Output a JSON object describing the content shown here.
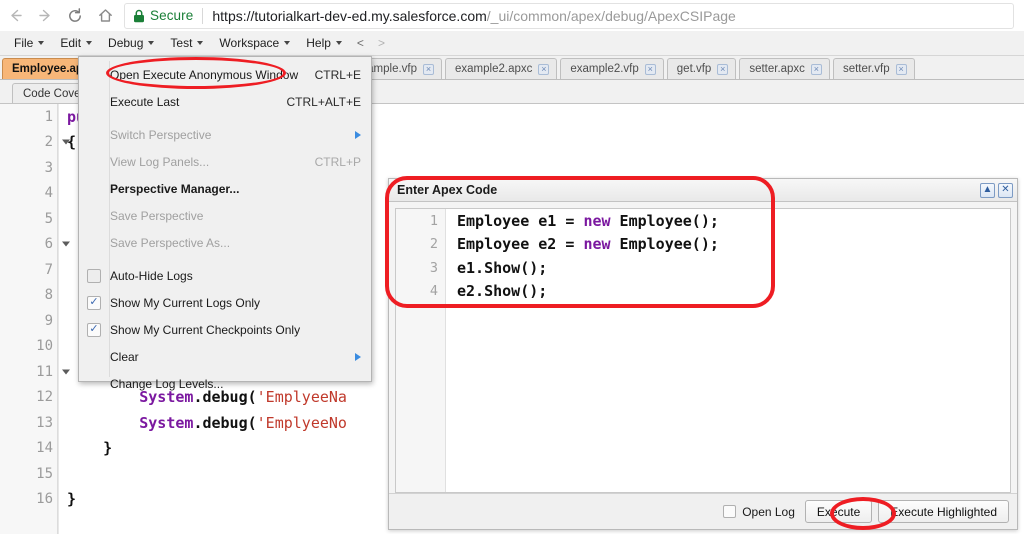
{
  "browser": {
    "nav": {
      "back": "back-arrow",
      "forward": "forward-arrow",
      "reload": "reload",
      "home": "home"
    },
    "secure_label": "Secure",
    "url_host": "https://tutorialkart-dev-ed.my.salesforce.com",
    "url_path": "/_ui/common/apex/debug/ApexCSIPage"
  },
  "menubar": {
    "items": [
      {
        "label": "File",
        "caret": true
      },
      {
        "label": "Edit",
        "caret": true
      },
      {
        "label": "Debug",
        "caret": true
      },
      {
        "label": "Test",
        "caret": true
      },
      {
        "label": "Workspace",
        "caret": true
      },
      {
        "label": "Help",
        "caret": true
      }
    ],
    "prev_arrow": "<",
    "next_arrow": ">"
  },
  "tabs": [
    {
      "label": "Employee.apxc",
      "active": true,
      "close": "×"
    },
    {
      "label": "example.vfp",
      "active": false,
      "close": "×"
    },
    {
      "label": "example2.apxc",
      "active": false,
      "close": "×"
    },
    {
      "label": "example2.vfp",
      "active": false,
      "close": "×"
    },
    {
      "label": "get.vfp",
      "active": false,
      "close": "×"
    },
    {
      "label": "setter.apxc",
      "active": false,
      "close": "×"
    },
    {
      "label": "setter.vfp",
      "active": false,
      "close": "×"
    }
  ],
  "subtabs": [
    {
      "label": "Code Coverage: None"
    }
  ],
  "editor": {
    "line_numbers": [
      "1",
      "2",
      "3",
      "4",
      "5",
      "6",
      "7",
      "8",
      "9",
      "10",
      "11",
      "12",
      "13",
      "14",
      "15",
      "16"
    ],
    "fold_lines": [
      "2",
      "6",
      "11"
    ],
    "lines": [
      {
        "n": "1",
        "segments": [
          {
            "text": "pu",
            "cls": "kw"
          }
        ]
      },
      {
        "n": "2",
        "segments": [
          {
            "text": "{",
            "cls": "pl"
          }
        ]
      },
      {
        "n": "3",
        "segments": []
      },
      {
        "n": "4",
        "segments": []
      },
      {
        "n": "5",
        "segments": []
      },
      {
        "n": "6",
        "segments": []
      },
      {
        "n": "7",
        "segments": []
      },
      {
        "n": "8",
        "segments": []
      },
      {
        "n": "9",
        "segments": []
      },
      {
        "n": "10",
        "segments": []
      },
      {
        "n": "11",
        "segments": []
      },
      {
        "n": "12",
        "segments": [
          {
            "text": "        System",
            "cls": "kw"
          },
          {
            "text": ".debug(",
            "cls": "pl"
          },
          {
            "text": "'EmplyeeNa",
            "cls": "str"
          }
        ]
      },
      {
        "n": "13",
        "segments": [
          {
            "text": "        System",
            "cls": "kw"
          },
          {
            "text": ".debug(",
            "cls": "pl"
          },
          {
            "text": "'EmplyeeNo",
            "cls": "str"
          }
        ]
      },
      {
        "n": "14",
        "segments": [
          {
            "text": "    }",
            "cls": "pl"
          }
        ]
      },
      {
        "n": "15",
        "segments": []
      },
      {
        "n": "16",
        "segments": [
          {
            "text": "}",
            "cls": "pl"
          }
        ]
      }
    ]
  },
  "debug_menu": {
    "rows": [
      {
        "kind": "item",
        "label": "Open Execute Anonymous Window",
        "accel": "CTRL+E",
        "disabled": false,
        "bold": false,
        "check": null,
        "submenu": false,
        "highlighted": true
      },
      {
        "kind": "item",
        "label": "Execute Last",
        "accel": "CTRL+ALT+E",
        "disabled": false,
        "bold": false,
        "check": null,
        "submenu": false,
        "highlighted": false
      },
      {
        "kind": "sep"
      },
      {
        "kind": "item",
        "label": "Switch Perspective",
        "accel": "",
        "disabled": true,
        "bold": false,
        "check": null,
        "submenu": true,
        "highlighted": false
      },
      {
        "kind": "item",
        "label": "View Log Panels...",
        "accel": "CTRL+P",
        "disabled": true,
        "bold": false,
        "check": null,
        "submenu": false,
        "highlighted": false
      },
      {
        "kind": "item",
        "label": "Perspective Manager...",
        "accel": "",
        "disabled": false,
        "bold": true,
        "check": null,
        "submenu": false,
        "highlighted": false
      },
      {
        "kind": "item",
        "label": "Save Perspective",
        "accel": "",
        "disabled": true,
        "bold": false,
        "check": null,
        "submenu": false,
        "highlighted": false
      },
      {
        "kind": "item",
        "label": "Save Perspective As...",
        "accel": "",
        "disabled": true,
        "bold": false,
        "check": null,
        "submenu": false,
        "highlighted": false
      },
      {
        "kind": "sep"
      },
      {
        "kind": "item",
        "label": "Auto-Hide Logs",
        "accel": "",
        "disabled": false,
        "bold": false,
        "check": "off",
        "submenu": false,
        "highlighted": false
      },
      {
        "kind": "item",
        "label": "Show My Current Logs Only",
        "accel": "",
        "disabled": false,
        "bold": false,
        "check": "on",
        "submenu": false,
        "highlighted": false
      },
      {
        "kind": "item",
        "label": "Show My Current Checkpoints Only",
        "accel": "",
        "disabled": false,
        "bold": false,
        "check": "on",
        "submenu": false,
        "highlighted": false
      },
      {
        "kind": "item",
        "label": "Clear",
        "accel": "",
        "disabled": false,
        "bold": false,
        "check": null,
        "submenu": true,
        "highlighted": false
      },
      {
        "kind": "item",
        "label": "Change Log Levels...",
        "accel": "",
        "disabled": false,
        "bold": false,
        "check": null,
        "submenu": false,
        "highlighted": false
      }
    ],
    "check_glyph": "✓"
  },
  "apex_dialog": {
    "title": "Enter Apex Code",
    "controls": {
      "collapse": "▲",
      "close": "✕"
    },
    "line_numbers": [
      "1",
      "2",
      "3",
      "4"
    ],
    "code_lines": [
      [
        {
          "text": "Employee e1 = ",
          "cls": "pl"
        },
        {
          "text": "new",
          "cls": "kw"
        },
        {
          "text": " Employee();",
          "cls": "pl"
        }
      ],
      [
        {
          "text": "Employee e2 = ",
          "cls": "pl"
        },
        {
          "text": "new",
          "cls": "kw"
        },
        {
          "text": " Employee();",
          "cls": "pl"
        }
      ],
      [
        {
          "text": "e1.Show();",
          "cls": "pl"
        }
      ],
      [
        {
          "text": "e2.Show();",
          "cls": "pl"
        }
      ]
    ],
    "footer": {
      "open_log_label": "Open Log",
      "execute_label": "Execute",
      "execute_highlighted_label": "Execute Highlighted"
    }
  },
  "colors": {
    "highlight_red": "#ee1d23",
    "secure_green": "#1a7f37",
    "active_tab": "#f7b678",
    "keyword_purple": "#7b18a0",
    "string_red": "#c0392b"
  }
}
